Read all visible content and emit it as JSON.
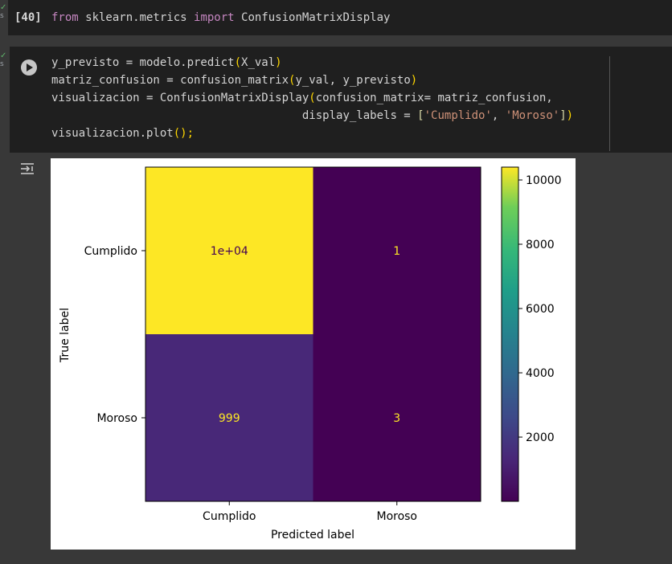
{
  "cell1": {
    "exec_count": "[40]",
    "status": "s",
    "line": {
      "k1": "from",
      "mod": " sklearn.metrics ",
      "k2": "import",
      "name": " ConfusionMatrixDisplay"
    }
  },
  "cell2": {
    "status": "s",
    "lines": [
      {
        "a": "y_previsto = modelo.predict",
        "b": "(",
        "c": "X_val",
        "d": ")"
      },
      {
        "a": "matriz_confusion = confusion_matrix",
        "b": "(",
        "c": "y_val, y_previsto",
        "d": ")"
      },
      {
        "a": "visualizacion = ConfusionMatrixDisplay",
        "b": "(",
        "c": "confusion_matrix= matriz_confusion,"
      },
      {
        "pad": "                                     ",
        "a": "display_labels = ",
        "b": "[",
        "s1": "'Cumplido'",
        "sep": ", ",
        "s2": "'Moroso'",
        "d": "]",
        "e": ")"
      },
      {
        "a": "visualizacion.plot",
        "b": "();"
      }
    ]
  },
  "chart_data": {
    "type": "heatmap",
    "title": "",
    "xlabel": "Predicted label",
    "ylabel": "True label",
    "x_categories": [
      "Cumplido",
      "Moroso"
    ],
    "y_categories": [
      "Cumplido",
      "Moroso"
    ],
    "matrix": [
      [
        10400,
        1
      ],
      [
        999,
        3
      ]
    ],
    "cell_labels": [
      [
        "1e+04",
        "1"
      ],
      [
        "999",
        "3"
      ]
    ],
    "colorbar": {
      "ticks": [
        2000,
        4000,
        6000,
        8000,
        10000
      ],
      "tick_labels": [
        "2000",
        "4000",
        "6000",
        "8000",
        "10000"
      ],
      "vmin": 1,
      "vmax": 10400
    },
    "colors": {
      "high": "#fde725",
      "mid": "#482878",
      "low": "#440154",
      "label_on_dark": "#fde725",
      "label_on_light": "#440154"
    }
  }
}
